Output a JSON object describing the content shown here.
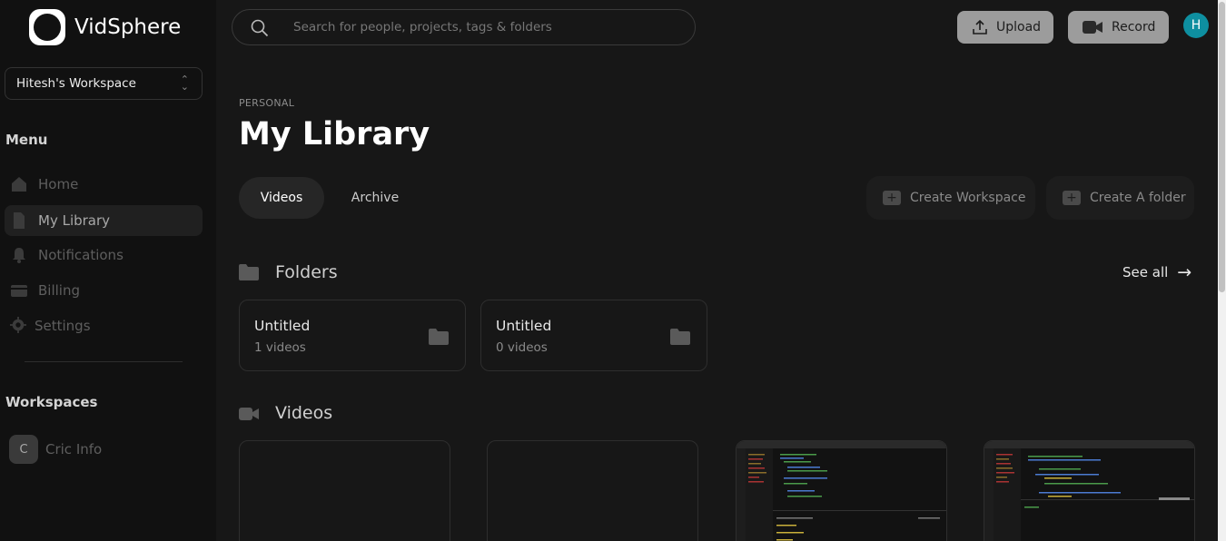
{
  "app": {
    "name": "VidSphere"
  },
  "sidebar": {
    "workspace_select": "Hitesh's Workspace",
    "menu_title": "Menu",
    "items": [
      {
        "label": "Home",
        "icon": "home-icon"
      },
      {
        "label": "My Library",
        "icon": "document-icon"
      },
      {
        "label": "Notifications",
        "icon": "bell-icon"
      },
      {
        "label": "Billing",
        "icon": "credit-card-icon"
      },
      {
        "label": "Settings",
        "icon": "gear-icon"
      }
    ],
    "workspaces_title": "Workspaces",
    "workspaces": [
      {
        "initial": "C",
        "label": "Cric Info"
      }
    ]
  },
  "header": {
    "search_placeholder": "Search for people, projects, tags & folders",
    "upload_label": "Upload",
    "record_label": "Record",
    "avatar_initial": "H"
  },
  "main": {
    "eyebrow": "PERSONAL",
    "title": "My Library",
    "tabs": [
      {
        "label": "Videos",
        "active": true
      },
      {
        "label": "Archive",
        "active": false
      }
    ],
    "create_workspace_label": "Create Workspace",
    "create_folder_label": "Create A folder",
    "folders_title": "Folders",
    "see_all_label": "See all",
    "folders": [
      {
        "name": "Untitled",
        "count": "1 videos"
      },
      {
        "name": "Untitled",
        "count": "0 videos"
      }
    ],
    "videos_title": "Videos"
  },
  "colors": {
    "accent_avatar": "#0e8fa0",
    "button_gray": "#9c9c9c",
    "background": "#171717",
    "sidebar": "#111111"
  }
}
